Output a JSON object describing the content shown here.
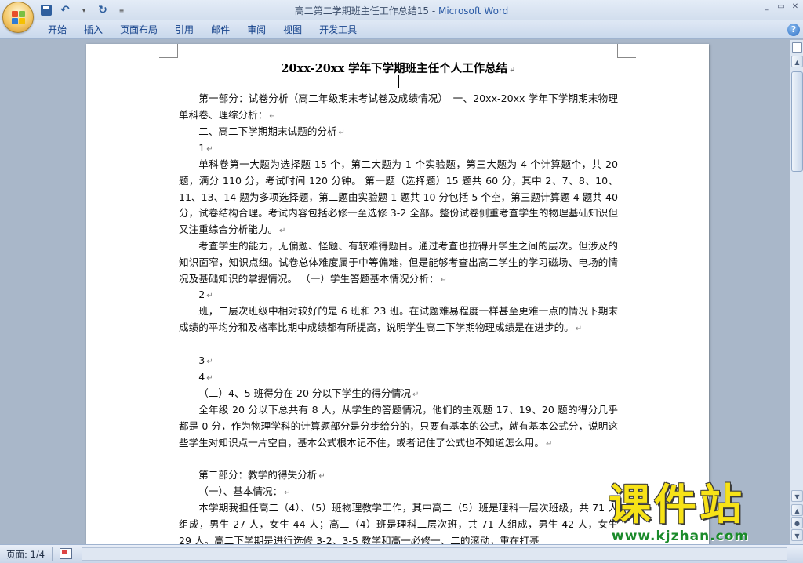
{
  "window": {
    "title_doc": "高二第二学期班主任工作总结15",
    "title_sep": " - ",
    "title_app": "Microsoft Word",
    "controls": [
      "_",
      "▭",
      "✕"
    ]
  },
  "quick_access": {
    "save_icon": "save-icon",
    "undo_glyph": "↶",
    "redo_glyph": "↻",
    "dropdown_glyph": "▾",
    "customize_glyph": "≡"
  },
  "ribbon": {
    "tabs": [
      "开始",
      "插入",
      "页面布局",
      "引用",
      "邮件",
      "审阅",
      "视图",
      "开发工具"
    ],
    "help": "?"
  },
  "document": {
    "title": "20xx-20xx 学年下学期班主任个人工作总结",
    "paragraphs": [
      "第一部分：试卷分析（高二年级期末考试卷及成绩情况）　一、20xx-20xx 学年下学期期末物理单科卷、理综分析：",
      "二、高二下学期期末试题的分析",
      "1",
      "单科卷第一大题为选择题 15 个，第二大题为 1 个实验题，第三大题为 4 个计算题个，共 20 题，满分 110 分，考试时间 120 分钟。 第一题（选择题）15 题共 60 分，其中 2、7、8、10、11、13、14 题为多项选择题，第二题由实验题 1 题共 10 分包括 5 个空，第三题计算题 4 题共 40 分，试卷结构合理。考试内容包括必修一至选修 3-2 全部。整份试卷侧重考查学生的物理基础知识但又注重综合分析能力。",
      "考查学生的能力，无偏题、怪题、有较难得题目。通过考查也拉得开学生之间的层次。但涉及的知识面窄，知识点细。试卷总体难度属于中等偏难，但是能够考查出高二学生的学习磁场、电场的情况及基础知识的掌握情况。 （一）学生答题基本情况分析：",
      "2",
      "班，二层次班级中相对较好的是 6 班和 23 班。在试题难易程度一样甚至更难一点的情况下期末成绩的平均分和及格率比期中成绩都有所提高，说明学生高二下学期物理成绩是在进步的。",
      "3",
      "4",
      "（二）4、5 班得分在 20 分以下学生的得分情况",
      "全年级 20 分以下总共有 8 人，从学生的答题情况，他们的主观题 17、19、20 题的得分几乎都是 0 分，作为物理学科的计算题部分是分步给分的，只要有基本的公式，就有基本公式分，说明这些学生对知识点一片空白，基本公式根本记不住，或者记住了公式也不知道怎么用。",
      "第二部分：教学的得失分析",
      "（一）、基本情况：",
      "本学期我担任高二（4）、（5）班物理教学工作，其中高二（5）班是理科一层次班级，共 71 人组成，男生 27 人，女生 44 人；高二（4）班是理科二层次班，共 71 人组成，男生 42 人，女生 29 人。高二下学期是进行选修 3-2、3-5 教学和高一必修一、二的滚动，重在打基"
    ],
    "para_mark": "↵"
  },
  "status": {
    "page": "页面: 1/4"
  },
  "watermark": {
    "title": "课件站",
    "url": "www.kjzhan.com"
  }
}
